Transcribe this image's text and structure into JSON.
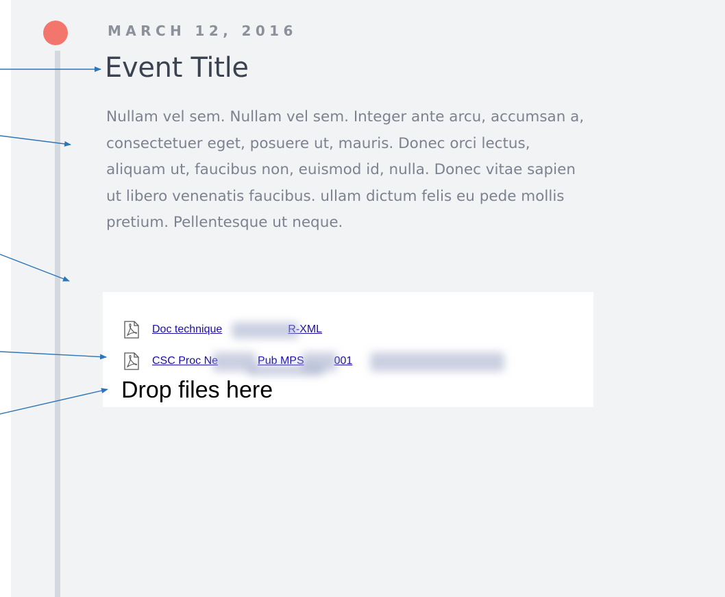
{
  "event": {
    "date": "MARCH 12, 2016",
    "title": "Event Title",
    "description_lines": [
      "Nullam vel sem. Nullam vel sem. Integer ante arcu, accumsan a,",
      "consectetuer eget, posuere ut, mauris. Donec orci lectus,",
      "aliquam ut, faucibus non, euismod id, nulla. Donec vitae sapien",
      "ut libero venenatis faucibus. ullam dictum felis eu pede mollis",
      "pretium. Pellentesque ut neque."
    ]
  },
  "attachments": {
    "files": [
      {
        "name_start": "Doc technique",
        "name_end": "R-XML",
        "icon": "pdf-icon"
      },
      {
        "name_start": "CSC Proc Ne",
        "name_mid": "Pub MPS",
        "name_end": "001",
        "icon": "pdf-icon"
      }
    ],
    "drop_label": "Drop files here"
  },
  "colors": {
    "timeline_dot": "#f2766c",
    "timeline_line": "#d4d9e0",
    "panel_bg": "#f2f3f5",
    "annotation_arrow": "#2e75b6",
    "link": "#1a0dab"
  }
}
